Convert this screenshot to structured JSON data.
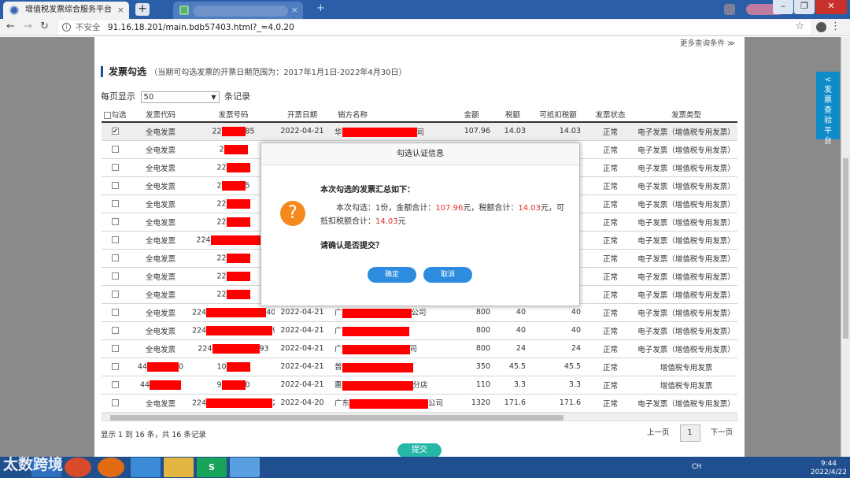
{
  "browser": {
    "active_tab_title": "增值税发票综合服务平台",
    "tab_close": "×",
    "new_tab": "+",
    "url_insecure": "不安全",
    "url": "91.16.18.201/main.bdb57403.html?_=4.0.20"
  },
  "page": {
    "more_filter": "更多查询条件 ≫",
    "section_title": "发票勾选",
    "section_sub": "（当期可勾选发票的开票日期范围为：2017年1月1日-2022年4月30日）",
    "perpage_label": "每页显示",
    "perpage_value": "50",
    "perpage_unit": "条记录",
    "columns": [
      "勾选",
      "发票代码",
      "发票号码",
      "开票日期",
      "销方名称",
      "金额",
      "税额",
      "可抵扣税额",
      "发票状态",
      "发票类型"
    ],
    "rows": [
      {
        "checked": "✔",
        "code": "全电发票",
        "num_pre": "22",
        "num_suf": "85",
        "date": "2022-04-21",
        "seller_pre": "华",
        "seller_suf": "司",
        "amount": "107.96",
        "tax": "14.03",
        "deduct": "14.03",
        "status": "正常",
        "type": "电子发票（增值税专用发票）"
      },
      {
        "checked": "",
        "code": "全电发票",
        "num_pre": "2",
        "num_suf": "",
        "date": "",
        "seller_pre": "",
        "seller_suf": "",
        "amount": "",
        "tax": "",
        "deduct": "",
        "status": "正常",
        "type": "电子发票（增值税专用发票）"
      },
      {
        "checked": "",
        "code": "全电发票",
        "num_pre": "22",
        "num_suf": "",
        "date": "",
        "seller_pre": "",
        "seller_suf": "",
        "amount": "",
        "tax": "",
        "deduct": "",
        "status": "正常",
        "type": "电子发票（增值税专用发票）"
      },
      {
        "checked": "",
        "code": "全电发票",
        "num_pre": "2",
        "num_suf": "5",
        "date": "",
        "seller_pre": "",
        "seller_suf": "",
        "amount": "",
        "tax": "",
        "deduct": "",
        "status": "正常",
        "type": "电子发票（增值税专用发票）"
      },
      {
        "checked": "",
        "code": "全电发票",
        "num_pre": "22",
        "num_suf": "",
        "date": "",
        "seller_pre": "",
        "seller_suf": "",
        "amount": "",
        "tax": "",
        "deduct": "",
        "status": "正常",
        "type": "电子发票（增值税专用发票）"
      },
      {
        "checked": "",
        "code": "全电发票",
        "num_pre": "22",
        "num_suf": "",
        "date": "",
        "seller_pre": "",
        "seller_suf": "",
        "amount": "",
        "tax": "",
        "deduct": "",
        "status": "正常",
        "type": "电子发票（增值税专用发票）"
      },
      {
        "checked": "",
        "code": "全电发票",
        "num_pre": "224",
        "num_suf": "",
        "date": "",
        "seller_pre": "",
        "seller_suf": "",
        "amount": "",
        "tax": "",
        "deduct": "",
        "status": "正常",
        "type": "电子发票（增值税专用发票）"
      },
      {
        "checked": "",
        "code": "全电发票",
        "num_pre": "22",
        "num_suf": "",
        "date": "",
        "seller_pre": "",
        "seller_suf": "",
        "amount": "",
        "tax": "",
        "deduct": "",
        "status": "正常",
        "type": "电子发票（增值税专用发票）"
      },
      {
        "checked": "",
        "code": "全电发票",
        "num_pre": "22",
        "num_suf": "",
        "date": "",
        "seller_pre": "",
        "seller_suf": "",
        "amount": "",
        "tax": "",
        "deduct": "",
        "status": "正常",
        "type": "电子发票（增值税专用发票）"
      },
      {
        "checked": "",
        "code": "全电发票",
        "num_pre": "22",
        "num_suf": "",
        "date": "",
        "seller_pre": "",
        "seller_suf": "",
        "amount": "",
        "tax": "",
        "deduct": "",
        "status": "正常",
        "type": "电子发票（增值税专用发票）"
      },
      {
        "checked": "",
        "code": "全电发票",
        "num_pre": "224",
        "num_suf": "40491",
        "date": "2022-04-21",
        "seller_pre": "广",
        "seller_suf": "公司",
        "amount": "800",
        "tax": "40",
        "deduct": "40",
        "status": "正常",
        "type": "电子发票（增值税专用发票）"
      },
      {
        "checked": "",
        "code": "全电发票",
        "num_pre": "224",
        "num_suf": "92",
        "date": "2022-04-21",
        "seller_pre": "广",
        "seller_suf": "",
        "amount": "800",
        "tax": "40",
        "deduct": "40",
        "status": "正常",
        "type": "电子发票（增值税专用发票）"
      },
      {
        "checked": "",
        "code": "全电发票",
        "num_pre": "224",
        "num_suf": "93",
        "date": "2022-04-21",
        "seller_pre": "广",
        "seller_suf": "司",
        "amount": "800",
        "tax": "24",
        "deduct": "24",
        "status": "正常",
        "type": "电子发票（增值税专用发票）"
      },
      {
        "checked": "",
        "code": "44",
        "code_suf": "0",
        "num_pre": "10",
        "num_suf": "",
        "date": "2022-04-21",
        "seller_pre": "普",
        "seller_suf": "",
        "amount": "350",
        "tax": "45.5",
        "deduct": "45.5",
        "status": "正常",
        "type": "增值税专用发票"
      },
      {
        "checked": "",
        "code": "44",
        "code_suf": "",
        "num_pre": "9",
        "num_suf": "0",
        "date": "2022-04-21",
        "seller_pre": "惠",
        "seller_suf": "分店",
        "amount": "110",
        "tax": "3.3",
        "deduct": "3.3",
        "status": "正常",
        "type": "增值税专用发票"
      },
      {
        "checked": "",
        "code": "全电发票",
        "num_pre": "224",
        "num_suf": "2",
        "date": "2022-04-20",
        "seller_pre": "广东",
        "seller_suf": "公司",
        "amount": "1320",
        "tax": "171.6",
        "deduct": "171.6",
        "status": "正常",
        "type": "电子发票（增值税专用发票）"
      }
    ],
    "footer_info": "显示 1 到 16 条，共 16 条记录",
    "prev": "上一页",
    "page_no": "1",
    "next": "下一页",
    "submit": "提交",
    "side_tab": "< 发 票 查 验 平 台"
  },
  "modal": {
    "title": "勾选认证信息",
    "heading": "本次勾选的发票汇总如下：",
    "l1": "本次勾选：1份，金额合计：",
    "amount": "107.96",
    "l2": "元，税额合计：",
    "tax": "14.03",
    "l3": "元，可抵扣税额合计：",
    "deduct": "14.03",
    "l4": "元",
    "confirm_q": "请确认是否提交？",
    "ok": "确定",
    "cancel": "取消"
  },
  "taskbar": {
    "watermark": "太数跨境",
    "tray_lang": "CH",
    "time": "9:44",
    "date": "2022/4/22"
  }
}
